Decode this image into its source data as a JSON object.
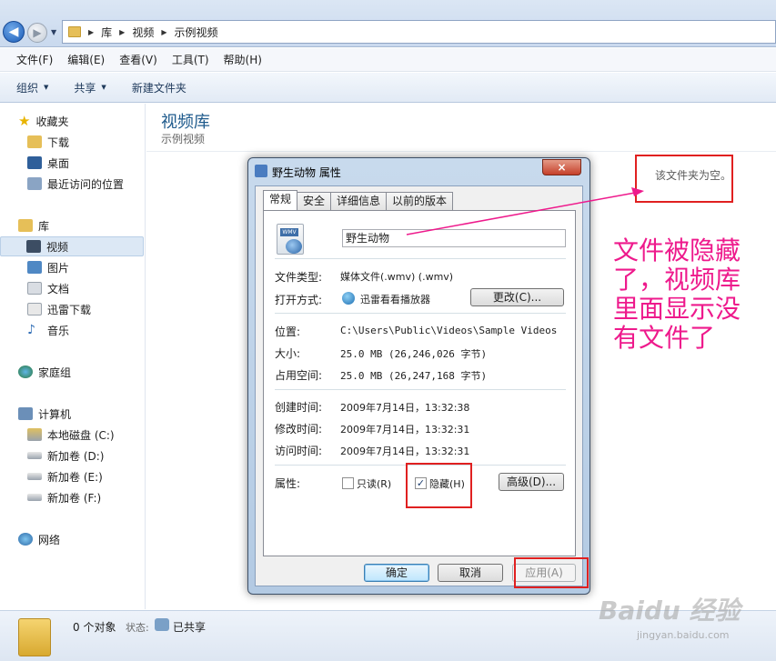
{
  "address_bar": {
    "crumbs": [
      "库",
      "视频",
      "示例视频"
    ]
  },
  "menu": [
    "文件(F)",
    "编辑(E)",
    "查看(V)",
    "工具(T)",
    "帮助(H)"
  ],
  "toolbar": {
    "organize": "组织",
    "share": "共享",
    "new_folder": "新建文件夹"
  },
  "sidebar": {
    "favorites": "收藏夹",
    "downloads": "下载",
    "desktop": "桌面",
    "recent": "最近访问的位置",
    "libraries": "库",
    "videos": "视频",
    "pictures": "图片",
    "documents": "文档",
    "xunlei": "迅雷下载",
    "music": "音乐",
    "homegroup": "家庭组",
    "computer": "计算机",
    "disk_c": "本地磁盘 (C:)",
    "disk_d": "新加卷 (D:)",
    "disk_e": "新加卷 (E:)",
    "disk_f": "新加卷 (F:)",
    "network": "网络"
  },
  "content": {
    "title": "视频库",
    "subtitle": "示例视频",
    "empty_text": "该文件夹为空。"
  },
  "annotation": {
    "text": "文件被隐藏了，视频库里面显示没有文件了"
  },
  "status": {
    "count": "0 个对象",
    "state_label": "状态:",
    "share_state": "已共享"
  },
  "watermark": {
    "brand": "Baidu 经验",
    "url": "jingyan.baidu.com"
  },
  "dialog": {
    "title": "野生动物 属性",
    "close": "×",
    "tabs": [
      "常规",
      "安全",
      "详细信息",
      "以前的版本"
    ],
    "file_icon_badge": "WMV",
    "file_name": "野生动物",
    "file_type_label": "文件类型:",
    "file_type_value": "媒体文件(.wmv) (.wmv)",
    "open_with_label": "打开方式:",
    "open_with_value": "迅雷看看播放器",
    "change_button": "更改(C)...",
    "location_label": "位置:",
    "location_value": "C:\\Users\\Public\\Videos\\Sample Videos",
    "size_label": "大小:",
    "size_value": "25.0 MB (26,246,026 字节)",
    "size_on_disk_label": "占用空间:",
    "size_on_disk_value": "25.0 MB (26,247,168 字节)",
    "created_label": "创建时间:",
    "created_value": "2009年7月14日，13:32:38",
    "modified_label": "修改时间:",
    "modified_value": "2009年7月14日，13:32:31",
    "accessed_label": "访问时间:",
    "accessed_value": "2009年7月14日，13:32:31",
    "attributes_label": "属性:",
    "readonly_label": "只读(R)",
    "readonly_checked": false,
    "hidden_label": "隐藏(H)",
    "hidden_checked": true,
    "advanced_button": "高级(D)...",
    "ok_button": "确定",
    "cancel_button": "取消",
    "apply_button": "应用(A)"
  },
  "colors": {
    "annotation": "#ee1a8c",
    "highlight_box": "#e02020"
  }
}
